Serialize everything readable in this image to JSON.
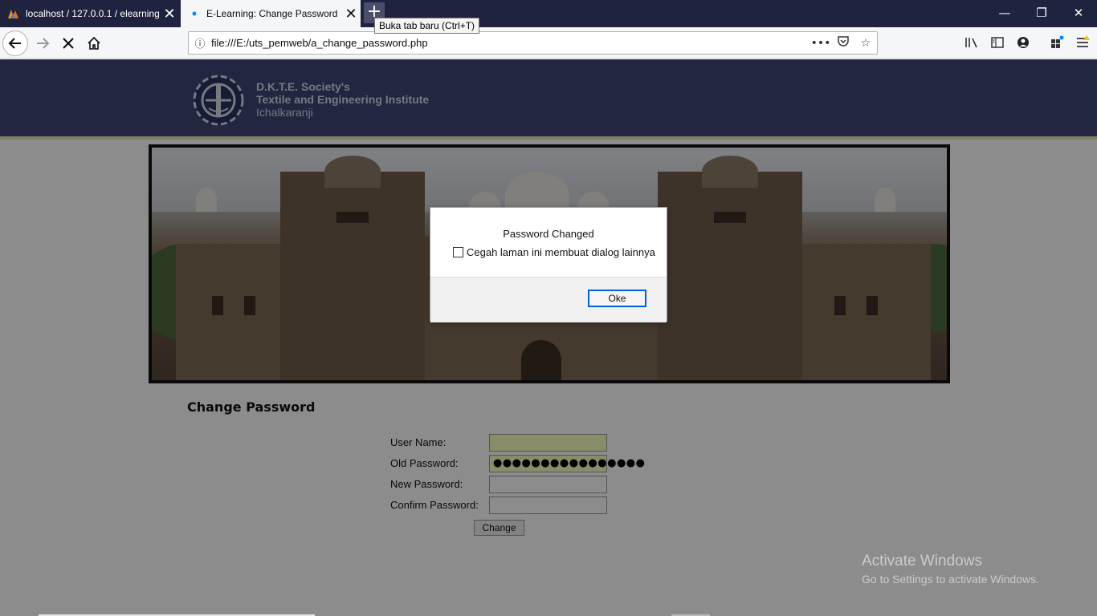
{
  "browser": {
    "tabs": [
      {
        "title": "localhost / 127.0.0.1 / elearning",
        "active": false
      },
      {
        "title": "E-Learning: Change Password",
        "active": true
      }
    ],
    "tooltip": "Buka tab baru (Ctrl+T)",
    "url": "file:///E:/uts_pemweb/a_change_password.php",
    "icons": [
      "back-arrow-icon",
      "forward-arrow-icon",
      "stop-icon",
      "home-icon",
      "info-icon",
      "more-icon",
      "pocket-icon",
      "star-icon",
      "library-icon",
      "sidebar-icon",
      "account-icon",
      "extensions-icon",
      "menu-icon"
    ],
    "colors": {
      "tabstrip": "#202340",
      "toolbar": "#f5f6f7",
      "accent": "#0060df"
    }
  },
  "site": {
    "org_line1": "D.K.T.E. Society's",
    "org_line2": "Textile and Engineering Institute",
    "org_line3": "Ichalkaranji",
    "header_color": "#3e4677"
  },
  "form": {
    "title": "Change Password",
    "fields": [
      {
        "label": "User Name:",
        "value": ""
      },
      {
        "label": "Old Password:",
        "value": "●●●●●●●●●●●●●●●●"
      },
      {
        "label": "New Password:",
        "value": ""
      },
      {
        "label": "Confirm Password:",
        "value": ""
      }
    ],
    "submit_label": "Change"
  },
  "dialog": {
    "message": "Password Changed",
    "checkbox_label": "Cegah laman ini membuat dialog lainnya",
    "checkbox_checked": false,
    "ok_label": "Oke"
  },
  "watermark": {
    "line1": "Activate Windows",
    "line2": "Go to Settings to activate Windows."
  }
}
